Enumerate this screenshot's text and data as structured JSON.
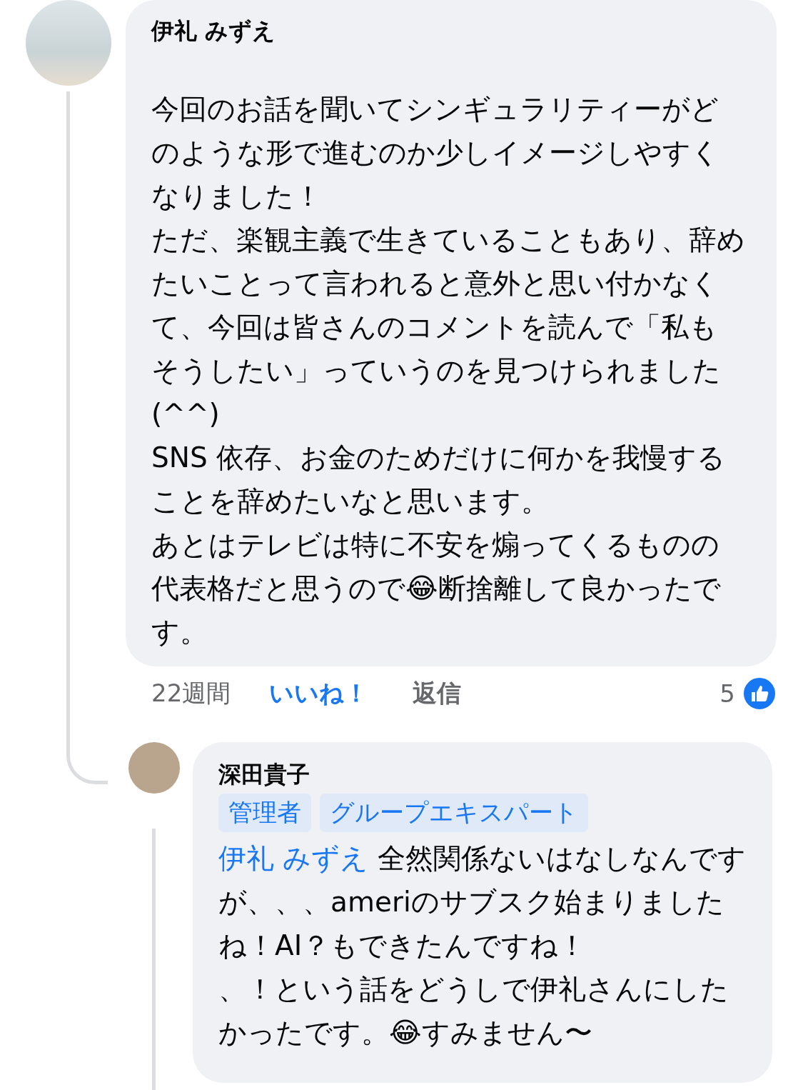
{
  "comment": {
    "author": "伊礼 みずえ",
    "paragraphs": [
      "今回のお話を聞いてシンギュラリティーがどのような形で進むのか少しイメージしやすくなりました！",
      "ただ、楽観主義で生きていることもあり、辞めたいことって言われると意外と思い付かなくて、今回は皆さんのコメントを読んで「私もそうしたい」っていうのを見つけられました (^^)",
      "SNS 依存、お金のためだけに何かを我慢することを辞めたいなと思います。",
      "あとはテレビは特に不安を煽ってくるものの代表格だと思うので😂断捨離して良かったです。"
    ],
    "time": "22週間",
    "like_label": "いいね！",
    "liked": true,
    "reply_label": "返信",
    "reaction_count": "5"
  },
  "reply": {
    "author": "深田貴子",
    "badges": [
      "管理者",
      "グループエキスパート"
    ],
    "mention": "伊礼 みずえ",
    "paragraphs": [
      "全然関係ないはなしなんですが、、、ameriのサブスク始まりましたね！AI？もできたんですね！",
      "、！という話をどうしで伊礼さんにしたかったです。😂すみません〜"
    ]
  }
}
